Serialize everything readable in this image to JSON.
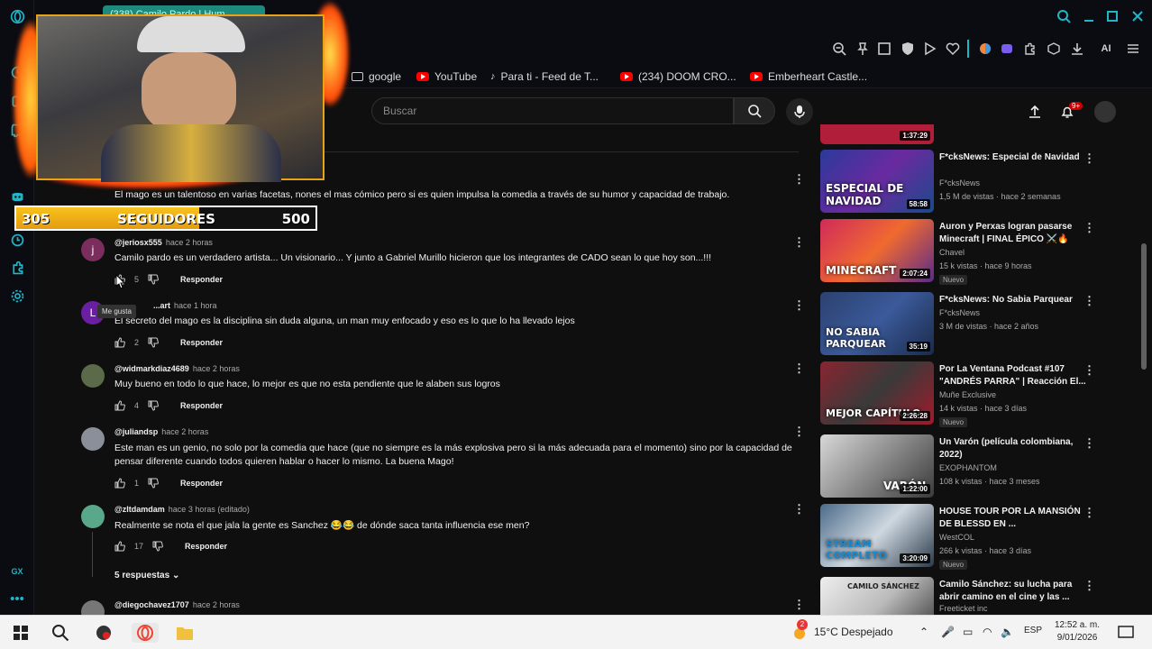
{
  "browser": {
    "tab_title": "(338) Camilo Pardo | Hum...",
    "bookmarks": [
      {
        "label": "google",
        "icon": "folder-icon"
      },
      {
        "label": "YouTube",
        "icon": "youtube-icon"
      },
      {
        "label": "Para ti - Feed de T...",
        "icon": "tiktok-icon"
      },
      {
        "label": "(234) DOOM CRO...",
        "icon": "youtube-icon"
      },
      {
        "label": "Emberheart Castle...",
        "icon": "youtube-icon"
      }
    ],
    "ai_label": "AI"
  },
  "youtube": {
    "search_placeholder": "Buscar",
    "notification_count": "9+"
  },
  "overlay": {
    "followers_current": "305",
    "followers_label": "SEGUIDORES",
    "followers_goal": "500",
    "followers_progress": 0.61
  },
  "comments": [
    {
      "author": "",
      "time": "",
      "text": "El mago es un talentoso en varias facetas, nones el mas cómico pero si es quien impulsa la comedia a través de su humor y capacidad de trabajo.",
      "likes": "",
      "reply_label": ""
    },
    {
      "author": "@jeriosx555",
      "time": "hace 2 horas",
      "text": "Camilo pardo es un verdadero artista... Un visionario... Y junto a Gabriel Murillo hicieron que los integrantes de CADO sean lo que hoy son...!!!",
      "likes": "5",
      "reply_label": "Responder",
      "avatar_letter": "j",
      "avatar_color": "#7b2d5e"
    },
    {
      "author": "...art",
      "time": "hace 1 hora",
      "text": "El secreto del mago es la disciplina sin duda alguna, un man muy enfocado y eso es lo que lo ha llevado lejos",
      "likes": "2",
      "reply_label": "Responder",
      "avatar_letter": "L",
      "avatar_color": "#6a1fa2"
    },
    {
      "author": "@widmarkdiaz4689",
      "time": "hace 2 horas",
      "text": "Muy bueno en todo lo que hace, lo mejor es que no esta pendiente que le alaben sus logros",
      "likes": "4",
      "reply_label": "Responder",
      "avatar_color": "#5b6b4a"
    },
    {
      "author": "@juliandsp",
      "time": "hace 2 horas",
      "text": "Este man es un genio, no solo por la comedia que hace (que no siempre es la más explosiva pero si la más adecuada para el momento) sino por la capacidad de pensar diferente cuando todos quieren hablar o hacer lo mismo. La buena Mago!",
      "likes": "1",
      "reply_label": "Responder",
      "avatar_color": "#8a8f99"
    },
    {
      "author": "@zltdamdam",
      "time": "hace 3 horas (editado)",
      "text": "Realmente se nota el que jala la gente es Sanchez 😂😂 de dónde saca tanta influencia ese men?",
      "likes": "17",
      "reply_label": "Responder",
      "avatar_color": "#5aa88a"
    },
    {
      "author": "@diegochavez1707",
      "time": "hace 2 horas",
      "text": "",
      "likes": "",
      "reply_label": "",
      "avatar_color": "#777"
    }
  ],
  "replies_toggle": "5 respuestas",
  "tooltip": "Me gusta",
  "sidebar_videos": [
    {
      "title": "F*cksNews: Especial de Navidad",
      "channel": "F*cksNews",
      "meta": "1,5 M de vistas · hace 2 semanas",
      "duration": "58:58",
      "new": "",
      "thumb_text": "ESPECIAL DE NAVIDAD",
      "thumb_color": "#3a4aa0"
    },
    {
      "title": "Auron y Perxas logran pasarse Minecraft | FINAL ÉPICO ⚔️🔥",
      "channel": "Chavel",
      "meta": "15 k vistas · hace 9 horas",
      "duration": "2:07:24",
      "new": "Nuevo",
      "thumb_text": "MINECRAFT",
      "thumb_color": "#c0304e"
    },
    {
      "title": "F*cksNews: No Sabia Parquear",
      "channel": "F*cksNews",
      "meta": "3 M de vistas · hace 2 años",
      "duration": "35:19",
      "new": "",
      "thumb_text": "NO SABIA PARQUEAR",
      "thumb_color": "#2b4170"
    },
    {
      "title": "Por La Ventana Podcast #107 \"ANDRÉS PARRA\" | Reacción El...",
      "channel": "Muñe Exclusive",
      "meta": "14 k vistas · hace 3 días",
      "duration": "2:26:28",
      "new": "Nuevo",
      "thumb_text": "MEJOR CAPÍTULO",
      "thumb_color": "#8a2430"
    },
    {
      "title": "Un Varón (película colombiana, 2022)",
      "channel": "EXOPHANTOM",
      "meta": "108 k vistas · hace 3 meses",
      "duration": "1:22:00",
      "new": "",
      "thumb_text": "VARÓN",
      "thumb_color": "#6a6a6a"
    },
    {
      "title": "HOUSE TOUR POR LA MANSIÓN DE BLESSD EN ...",
      "channel": "WestCOL",
      "meta": "266 k vistas · hace 3 días",
      "duration": "3:20:09",
      "new": "Nuevo",
      "thumb_text": "STREAM COMPLETO",
      "thumb_color": "#4b6b8a"
    },
    {
      "title": "Camilo Sánchez: su lucha para abrir camino en el cine y las ...",
      "channel": "Freeticket inc",
      "meta": "",
      "duration": "",
      "new": "",
      "thumb_text": "CAMILO SÁNCHEZ",
      "thumb_color": "#ddd"
    }
  ],
  "top_partial_duration": "1:37:29",
  "taskbar": {
    "weather_badge": "2",
    "weather": "15°C  Despejado",
    "language": "ESP",
    "time": "12:52 a. m.",
    "date": "9/01/2026"
  },
  "gx_label": "GX"
}
